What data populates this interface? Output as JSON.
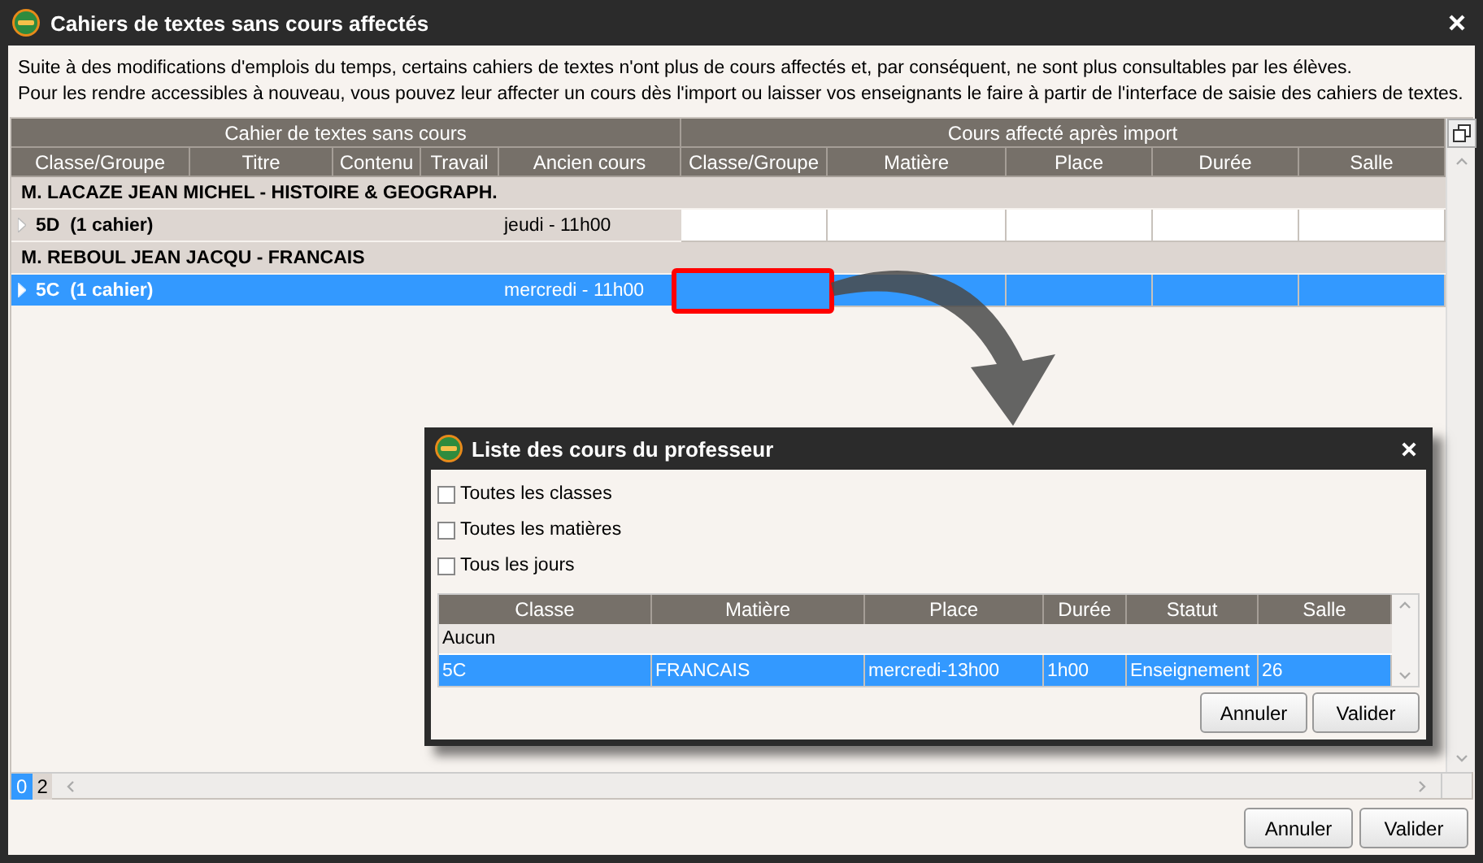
{
  "window": {
    "title": "Cahiers de textes sans cours affectés"
  },
  "description": [
    "Suite à des modifications d'emplois du temps, certains cahiers de textes n'ont plus de cours affectés et, par conséquent, ne sont plus consultables par les élèves.",
    "Pour les rendre accessibles à nouveau, vous pouvez leur affecter un cours dès l'import ou laisser vos enseignants le faire à partir de l'interface de saisie des cahiers de textes."
  ],
  "table": {
    "group_headers": [
      "Cahier de textes sans cours",
      "Cours affecté après import"
    ],
    "columns": [
      "Classe/Groupe",
      "Titre",
      "Contenu",
      "Travail",
      "Ancien cours",
      "Classe/Groupe",
      "Matière",
      "Place",
      "Durée",
      "Salle"
    ],
    "groups": [
      {
        "teacher": "M. LACAZE JEAN MICHEL - HISTOIRE & GEOGRAPH.",
        "rows": [
          {
            "label": "5D  (1 cahier)",
            "ancien_cours": "jeudi - 11h00",
            "selected": false,
            "outlined": false
          }
        ]
      },
      {
        "teacher": "M. REBOUL JEAN JACQU - FRANCAIS",
        "rows": [
          {
            "label": "5C  (1 cahier)",
            "ancien_cours": "mercredi - 11h00",
            "selected": true,
            "outlined": true
          }
        ]
      }
    ]
  },
  "page_tabs": [
    {
      "label": "0",
      "selected": true
    },
    {
      "label": "2",
      "selected": false
    }
  ],
  "buttons": [
    "Annuler",
    "Valider"
  ],
  "dialog": {
    "title": "Liste des cours du professeur",
    "filters": [
      {
        "label": "Toutes les classes",
        "checked": false
      },
      {
        "label": "Toutes les matières",
        "checked": false
      },
      {
        "label": "Tous les jours",
        "checked": false
      }
    ],
    "columns": [
      "Classe",
      "Matière",
      "Place",
      "Durée",
      "Statut",
      "Salle"
    ],
    "rows": [
      {
        "kind": "none",
        "cells": [
          "Aucun"
        ],
        "selected": false
      },
      {
        "kind": "course",
        "cells": [
          "5C",
          "FRANCAIS",
          "mercredi-13h00",
          "1h00",
          "Enseignement",
          "26"
        ],
        "selected": true
      }
    ],
    "buttons": [
      "Annuler",
      "Valider"
    ]
  }
}
